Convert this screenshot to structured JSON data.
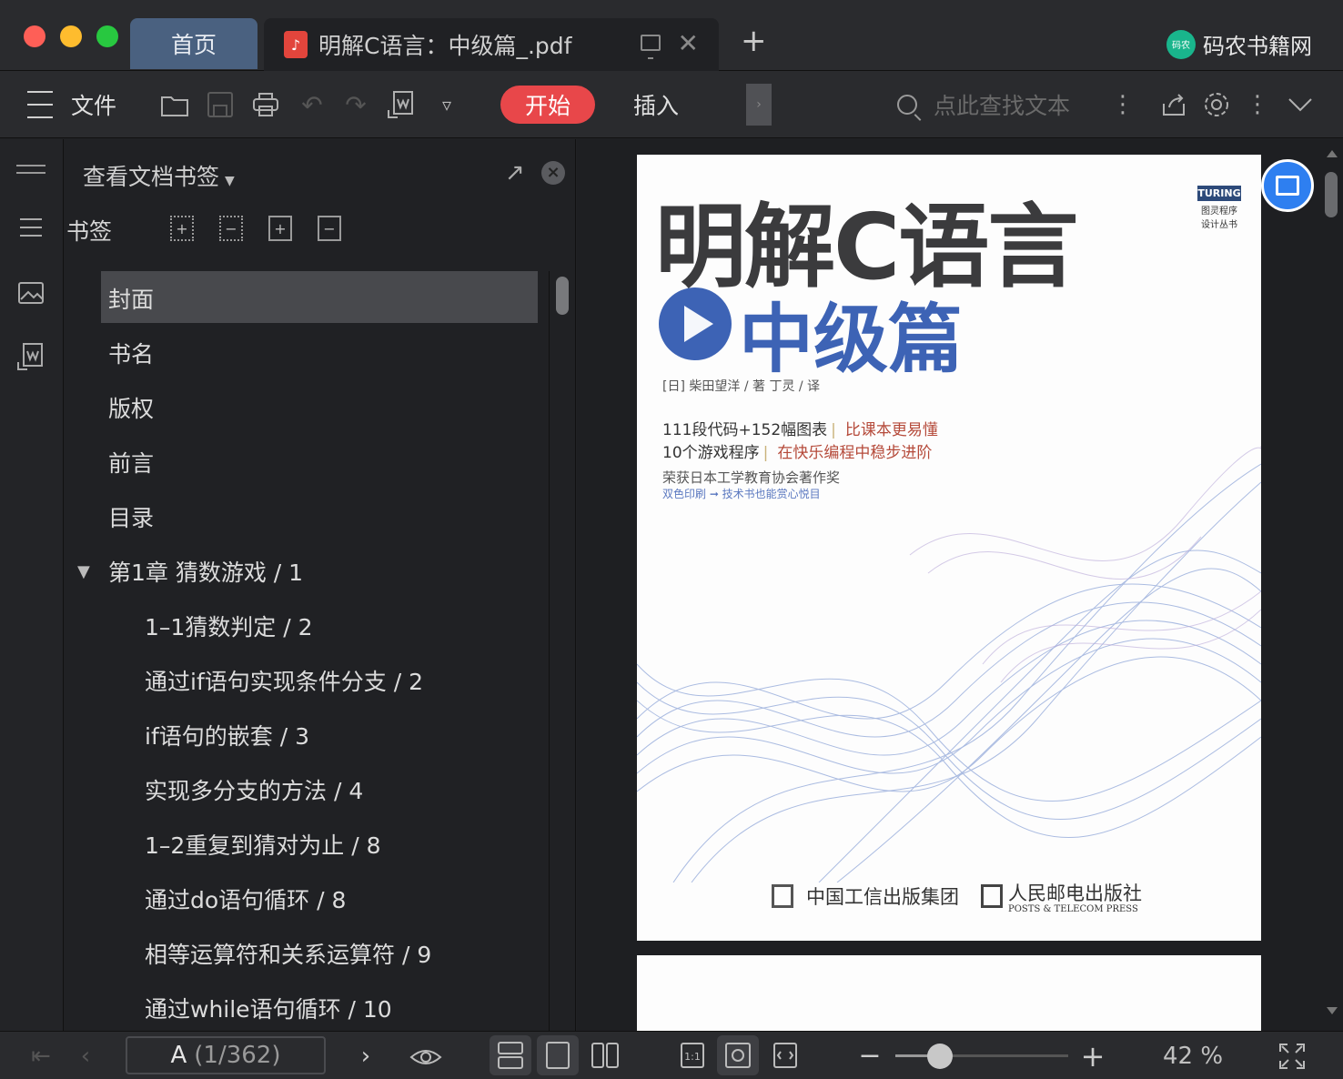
{
  "window": {
    "tabs": [
      {
        "label": "首页"
      },
      {
        "label": "明解C语言：中级篇_.pdf",
        "icon": "pdf-file-icon"
      }
    ],
    "brand": {
      "logo_text": "码农",
      "name": "码农书籍网"
    }
  },
  "toolbar": {
    "file_label": "文件",
    "start_label": "开始",
    "insert_label": "插入",
    "search_placeholder": "点此查找文本",
    "accent_color": "#e8474a"
  },
  "panel": {
    "title": "查看文档书签",
    "bookmark_label": "书签",
    "items": [
      {
        "label": "封面",
        "level": 0,
        "selected": true
      },
      {
        "label": "书名",
        "level": 0
      },
      {
        "label": "版权",
        "level": 0
      },
      {
        "label": "前言",
        "level": 0
      },
      {
        "label": "目录",
        "level": 0
      },
      {
        "label": "第1章  猜数游戏 / 1",
        "level": 0,
        "expanded": true
      },
      {
        "label": "1–1猜数判定 / 2",
        "level": 1
      },
      {
        "label": "通过if语句实现条件分支 / 2",
        "level": 1
      },
      {
        "label": "if语句的嵌套 / 3",
        "level": 1
      },
      {
        "label": "实现多分支的方法 / 4",
        "level": 1
      },
      {
        "label": "1–2重复到猜对为止 / 8",
        "level": 1
      },
      {
        "label": "通过do语句循环 / 8",
        "level": 1
      },
      {
        "label": "相等运算符和关系运算符 / 9",
        "level": 1
      },
      {
        "label": "通过while语句循环 / 10",
        "level": 1
      }
    ]
  },
  "cover": {
    "title": "明解C语言",
    "subtitle": "中级篇",
    "series_badge": "TURING",
    "series_line1": "图灵程序",
    "series_line2": "设计丛书",
    "authors": "[日] 柴田望洋 / 著  丁灵 / 译",
    "feature1_a": "111段代码+152幅图表",
    "feature1_b": "比课本更易懂",
    "feature2_a": "10个游戏程序",
    "feature2_b": "在快乐编程中稳步进阶",
    "award": "荣获日本工学教育协会著作奖",
    "award_sub": "双色印刷 ➞ 技术书也能赏心悦目",
    "publisher1": "中国工信出版集团",
    "publisher2": "人民邮电出版社",
    "publisher2_en": "POSTS & TELECOM PRESS"
  },
  "statusbar": {
    "page_current": "A",
    "page_total": "(1/362)",
    "zoom": "42 %",
    "zoom_fraction": 0.26
  }
}
